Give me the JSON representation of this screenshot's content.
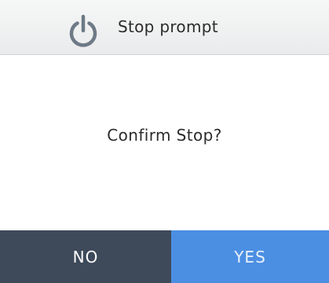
{
  "header": {
    "icon": "power-icon",
    "title": "Stop prompt"
  },
  "dialog": {
    "message": "Confirm Stop?"
  },
  "buttons": {
    "no_label": "NO",
    "yes_label": "YES"
  },
  "colors": {
    "header_bg": "#eceded",
    "icon": "#6e7a86",
    "no_button_bg": "#3e4a5a",
    "yes_button_bg": "#4b8fe3"
  }
}
